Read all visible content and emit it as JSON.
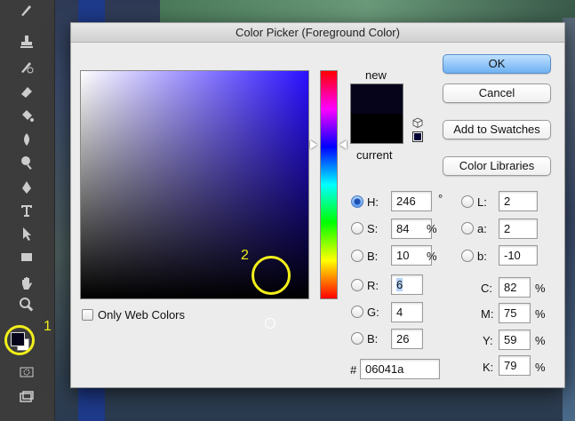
{
  "dialog": {
    "title": "Color Picker (Foreground Color)",
    "new_label": "new",
    "current_label": "current",
    "new_color": "#06041a",
    "current_color": "#000000",
    "buttons": {
      "ok": "OK",
      "cancel": "Cancel",
      "add_to_swatches": "Add to Swatches",
      "color_libraries": "Color Libraries"
    },
    "only_web_colors": "Only Web Colors",
    "hsb": {
      "h": {
        "label": "H:",
        "value": "246",
        "unit": "°"
      },
      "s": {
        "label": "S:",
        "value": "84",
        "unit": "%"
      },
      "b": {
        "label": "B:",
        "value": "10",
        "unit": "%"
      }
    },
    "rgb": {
      "r": {
        "label": "R:",
        "value": "6"
      },
      "g": {
        "label": "G:",
        "value": "4"
      },
      "b": {
        "label": "B:",
        "value": "26"
      }
    },
    "lab": {
      "l": {
        "label": "L:",
        "value": "2"
      },
      "a": {
        "label": "a:",
        "value": "2"
      },
      "b": {
        "label": "b:",
        "value": "-10"
      }
    },
    "cmyk": {
      "c": {
        "label": "C:",
        "value": "82",
        "unit": "%"
      },
      "m": {
        "label": "M:",
        "value": "75",
        "unit": "%"
      },
      "y": {
        "label": "Y:",
        "value": "59",
        "unit": "%"
      },
      "k": {
        "label": "K:",
        "value": "79",
        "unit": "%"
      }
    },
    "hex": {
      "label": "#",
      "value": "06041a"
    }
  },
  "annotations": {
    "one": "1",
    "two": "2"
  },
  "toolbar_icons": [
    "brush-icon",
    "stamp-icon",
    "history-brush-icon",
    "eraser-icon",
    "bucket-icon",
    "blur-icon",
    "dodge-icon",
    "pen-icon",
    "type-icon",
    "path-select-icon",
    "rectangle-icon",
    "hand-icon",
    "zoom-icon",
    "quick-mask-icon",
    "screen-mode-icon"
  ],
  "accent_yellow": "#f2ef1a"
}
